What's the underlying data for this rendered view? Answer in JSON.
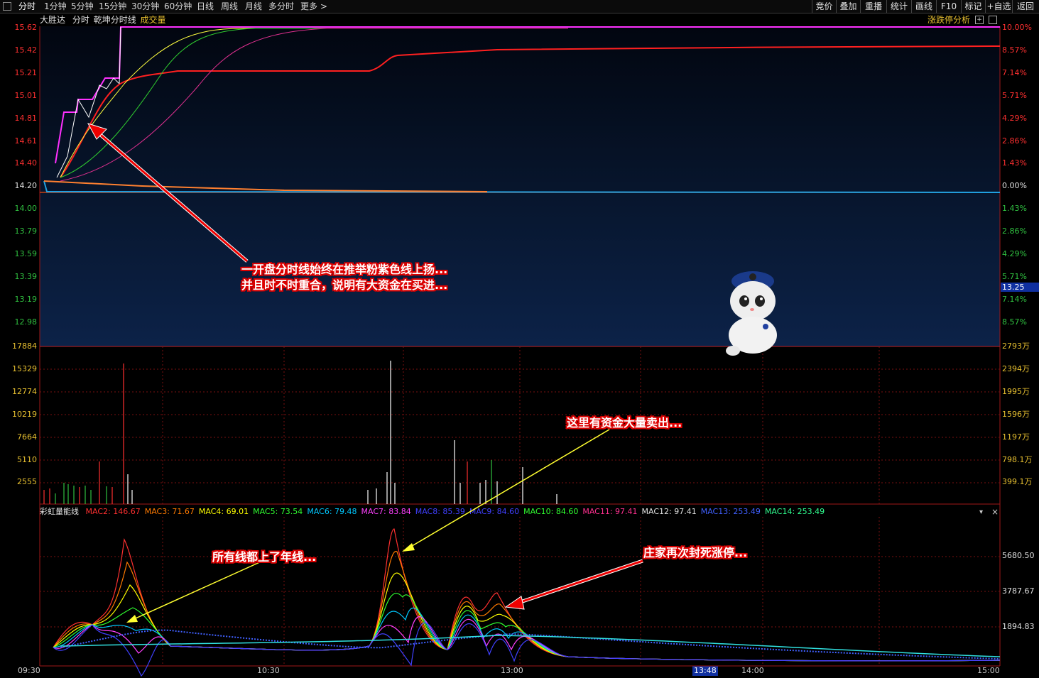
{
  "toolbar": {
    "tabs": [
      "分时",
      "1分钟",
      "5分钟",
      "15分钟",
      "30分钟",
      "60分钟",
      "日线",
      "周线",
      "月线",
      "多分时",
      "更多"
    ],
    "right_buttons": [
      "竞价",
      "叠加",
      "重播",
      "统计",
      "画线",
      "F10",
      "标记",
      "+自选",
      "返回"
    ]
  },
  "header": {
    "stock_name": "大胜达",
    "chart_mode": "分时",
    "line_name": "乾坤分时线",
    "volume_label": "成交量",
    "limit_analysis": "涨跌停分析"
  },
  "price_axis": {
    "left": [
      "15.62",
      "15.42",
      "15.21",
      "15.01",
      "14.81",
      "14.61",
      "14.40",
      "14.20",
      "14.00",
      "13.79",
      "13.59",
      "13.39",
      "13.19",
      "12.98"
    ],
    "right": [
      "10.00%",
      "8.57%",
      "7.14%",
      "5.71%",
      "4.29%",
      "2.86%",
      "1.43%",
      "0.00%",
      "1.43%",
      "2.86%",
      "4.29%",
      "5.71%",
      "7.14%",
      "8.57%"
    ],
    "current_price_tag": "13.25"
  },
  "volume_axis": {
    "left": [
      "17884",
      "15329",
      "12774",
      "10219",
      "7664",
      "5110",
      "2555"
    ],
    "right": [
      "2793万",
      "2394万",
      "1995万",
      "1596万",
      "1197万",
      "798.1万",
      "399.1万"
    ]
  },
  "indicator": {
    "name": "彩虹量能线",
    "legend": [
      {
        "label": "MAC2: 146.67",
        "color": "#ff3030"
      },
      {
        "label": "MAC3: 71.67",
        "color": "#ff7a00"
      },
      {
        "label": "MAC4: 69.01",
        "color": "#ffff00"
      },
      {
        "label": "MAC5: 73.54",
        "color": "#30ff30"
      },
      {
        "label": "MAC6: 79.48",
        "color": "#00c8ff"
      },
      {
        "label": "MAC7: 83.84",
        "color": "#ff40ff"
      },
      {
        "label": "MAC8: 85.39",
        "color": "#4040ff"
      },
      {
        "label": "MAC9: 84.60",
        "color": "#4040ff"
      },
      {
        "label": "MAC10: 84.60",
        "color": "#30ff30"
      },
      {
        "label": "MAC11: 97.41",
        "color": "#ff3090"
      },
      {
        "label": "MAC12: 97.41",
        "color": "#e0e0e0"
      },
      {
        "label": "MAC13: 253.49",
        "color": "#4060ff"
      },
      {
        "label": "MAC14: 253.49",
        "color": "#30ff90"
      }
    ],
    "right_axis": [
      "5680.50",
      "3787.67",
      "1894.83"
    ]
  },
  "time_axis": [
    "09:30",
    "10:30",
    "13:00",
    "13:48",
    "14:00",
    "15:00"
  ],
  "annotations": {
    "a1_line1": "一开盘分时线始终在推举粉紫色线上扬...",
    "a1_line2": "并且时不时重合，说明有大资金在买进...",
    "a2": "这里有资金大量卖出...",
    "a3": "所有线都上了年线...",
    "a4": "庄家再次封死涨停..."
  }
}
